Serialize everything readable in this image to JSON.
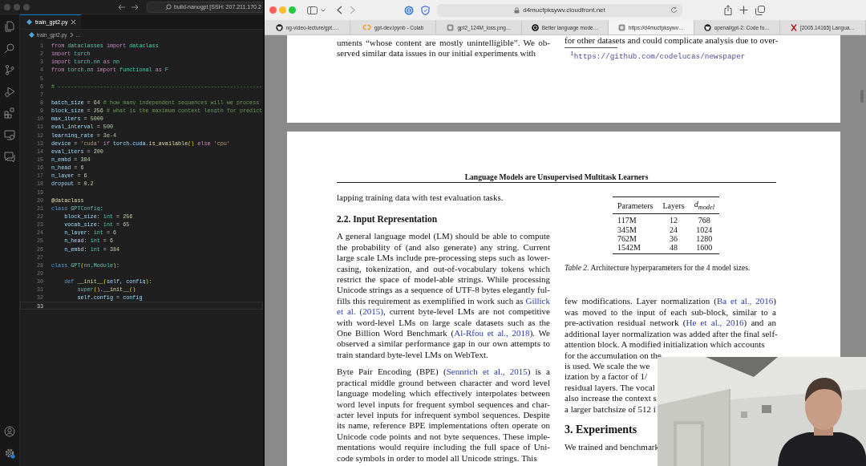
{
  "editor": {
    "command_center": "build-nanogpt [SSH: 207.211.170.2",
    "tab": {
      "label": "train_gpt2.py",
      "selected": true
    },
    "breadcrumb": [
      "train_gpt2.py",
      "..."
    ],
    "lines": [
      {
        "no": "1",
        "current": false,
        "tokens": [
          {
            "text": "from ",
            "kind": "keyword"
          },
          {
            "text": "dataclasses ",
            "kind": "module"
          },
          {
            "text": "import ",
            "kind": "keyword"
          },
          {
            "text": "dataclass",
            "kind": "module"
          }
        ]
      },
      {
        "no": "2",
        "current": false,
        "tokens": [
          {
            "text": "import ",
            "kind": "keyword"
          },
          {
            "text": "torch",
            "kind": "module"
          }
        ]
      },
      {
        "no": "3",
        "current": false,
        "tokens": [
          {
            "text": "import ",
            "kind": "keyword"
          },
          {
            "text": "torch.nn ",
            "kind": "module"
          },
          {
            "text": "as ",
            "kind": "keyword"
          },
          {
            "text": "nn",
            "kind": "module"
          }
        ]
      },
      {
        "no": "4",
        "current": false,
        "tokens": [
          {
            "text": "from ",
            "kind": "keyword"
          },
          {
            "text": "torch.nn ",
            "kind": "module"
          },
          {
            "text": "import ",
            "kind": "keyword"
          },
          {
            "text": "functional ",
            "kind": "module"
          },
          {
            "text": "as ",
            "kind": "keyword"
          },
          {
            "text": "F",
            "kind": "module"
          }
        ]
      },
      {
        "no": "5",
        "current": false
      },
      {
        "no": "6",
        "current": false,
        "tokens": [
          {
            "text": "# ---------------------------------------------------------------",
            "kind": "comment"
          }
        ]
      },
      {
        "no": "7",
        "current": false
      },
      {
        "no": "8",
        "current": false,
        "tokens": [
          {
            "text": "batch_size",
            "kind": "variable"
          },
          {
            "text": " = ",
            "kind": "plain"
          },
          {
            "text": "64",
            "kind": "number"
          },
          {
            "text": " # how many independent sequences will we process",
            "kind": "comment"
          }
        ]
      },
      {
        "no": "9",
        "current": false,
        "tokens": [
          {
            "text": "block_size",
            "kind": "variable"
          },
          {
            "text": " = ",
            "kind": "plain"
          },
          {
            "text": "256",
            "kind": "number"
          },
          {
            "text": " # what is the maximum context length for predict",
            "kind": "comment"
          }
        ]
      },
      {
        "no": "10",
        "current": false,
        "tokens": [
          {
            "text": "max_iters",
            "kind": "variable"
          },
          {
            "text": " = ",
            "kind": "plain"
          },
          {
            "text": "5000",
            "kind": "number"
          }
        ]
      },
      {
        "no": "11",
        "current": false,
        "tokens": [
          {
            "text": "eval_interval",
            "kind": "variable"
          },
          {
            "text": " = ",
            "kind": "plain"
          },
          {
            "text": "500",
            "kind": "number"
          }
        ]
      },
      {
        "no": "12",
        "current": false,
        "tokens": [
          {
            "text": "learning_rate",
            "kind": "variable"
          },
          {
            "text": " = ",
            "kind": "plain"
          },
          {
            "text": "3e-4",
            "kind": "number"
          }
        ]
      },
      {
        "no": "13",
        "current": false,
        "tokens": [
          {
            "text": "device",
            "kind": "variable"
          },
          {
            "text": " = ",
            "kind": "plain"
          },
          {
            "text": "'cuda'",
            "kind": "string"
          },
          {
            "text": " if ",
            "kind": "keyword"
          },
          {
            "text": "torch",
            "kind": "variable"
          },
          {
            "text": ".",
            "kind": "plain"
          },
          {
            "text": "cuda",
            "kind": "variable"
          },
          {
            "text": ".",
            "kind": "plain"
          },
          {
            "text": "is_available",
            "kind": "function"
          },
          {
            "text": "()",
            "kind": "bracket"
          },
          {
            "text": " else ",
            "kind": "keyword"
          },
          {
            "text": "'cpu'",
            "kind": "string"
          }
        ]
      },
      {
        "no": "14",
        "current": false,
        "tokens": [
          {
            "text": "eval_iters",
            "kind": "variable"
          },
          {
            "text": " = ",
            "kind": "plain"
          },
          {
            "text": "200",
            "kind": "number"
          }
        ]
      },
      {
        "no": "15",
        "current": false,
        "tokens": [
          {
            "text": "n_embd",
            "kind": "variable"
          },
          {
            "text": " = ",
            "kind": "plain"
          },
          {
            "text": "384",
            "kind": "number"
          }
        ]
      },
      {
        "no": "16",
        "current": false,
        "tokens": [
          {
            "text": "n_head",
            "kind": "variable"
          },
          {
            "text": " = ",
            "kind": "plain"
          },
          {
            "text": "6",
            "kind": "number"
          }
        ]
      },
      {
        "no": "17",
        "current": false,
        "tokens": [
          {
            "text": "n_layer",
            "kind": "variable"
          },
          {
            "text": " = ",
            "kind": "plain"
          },
          {
            "text": "6",
            "kind": "number"
          }
        ]
      },
      {
        "no": "18",
        "current": false,
        "tokens": [
          {
            "text": "dropout",
            "kind": "variable"
          },
          {
            "text": " = ",
            "kind": "plain"
          },
          {
            "text": "0.2",
            "kind": "number"
          }
        ]
      },
      {
        "no": "19",
        "current": false
      },
      {
        "no": "20",
        "current": false,
        "tokens": [
          {
            "text": "@dataclass",
            "kind": "function"
          }
        ]
      },
      {
        "no": "21",
        "current": false,
        "tokens": [
          {
            "text": "class ",
            "kind": "declaration"
          },
          {
            "text": "GPTConfig",
            "kind": "module"
          },
          {
            "text": ":",
            "kind": "plain"
          }
        ]
      },
      {
        "no": "22",
        "current": false,
        "tokens": [
          {
            "text": "    block_size",
            "kind": "variable"
          },
          {
            "text": ": ",
            "kind": "plain"
          },
          {
            "text": "int",
            "kind": "module"
          },
          {
            "text": " = ",
            "kind": "plain"
          },
          {
            "text": "256",
            "kind": "number"
          }
        ]
      },
      {
        "no": "23",
        "current": false,
        "tokens": [
          {
            "text": "    vocab_size",
            "kind": "variable"
          },
          {
            "text": ": ",
            "kind": "plain"
          },
          {
            "text": "int",
            "kind": "module"
          },
          {
            "text": " = ",
            "kind": "plain"
          },
          {
            "text": "65",
            "kind": "number"
          }
        ]
      },
      {
        "no": "24",
        "current": false,
        "tokens": [
          {
            "text": "    n_layer",
            "kind": "variable"
          },
          {
            "text": ": ",
            "kind": "plain"
          },
          {
            "text": "int",
            "kind": "module"
          },
          {
            "text": " = ",
            "kind": "plain"
          },
          {
            "text": "6",
            "kind": "number"
          }
        ]
      },
      {
        "no": "25",
        "current": false,
        "tokens": [
          {
            "text": "    n_head",
            "kind": "variable"
          },
          {
            "text": ": ",
            "kind": "plain"
          },
          {
            "text": "int",
            "kind": "module"
          },
          {
            "text": " = ",
            "kind": "plain"
          },
          {
            "text": "6",
            "kind": "number"
          }
        ]
      },
      {
        "no": "26",
        "current": false,
        "tokens": [
          {
            "text": "    n_embd",
            "kind": "variable"
          },
          {
            "text": ": ",
            "kind": "plain"
          },
          {
            "text": "int",
            "kind": "module"
          },
          {
            "text": " = ",
            "kind": "plain"
          },
          {
            "text": "384",
            "kind": "number"
          }
        ]
      },
      {
        "no": "27",
        "current": false
      },
      {
        "no": "28",
        "current": false,
        "tokens": [
          {
            "text": "class ",
            "kind": "declaration"
          },
          {
            "text": "GPT",
            "kind": "module"
          },
          {
            "text": "(",
            "kind": "bracket"
          },
          {
            "text": "nn",
            "kind": "module"
          },
          {
            "text": ".",
            "kind": "plain"
          },
          {
            "text": "Module",
            "kind": "module"
          },
          {
            "text": ")",
            "kind": "bracket"
          },
          {
            "text": ":",
            "kind": "plain"
          }
        ]
      },
      {
        "no": "29",
        "current": false
      },
      {
        "no": "30",
        "current": false,
        "tokens": [
          {
            "text": "    def ",
            "kind": "declaration"
          },
          {
            "text": "__init__",
            "kind": "function"
          },
          {
            "text": "(",
            "kind": "bracket"
          },
          {
            "text": "self",
            "kind": "variable"
          },
          {
            "text": ", ",
            "kind": "plain"
          },
          {
            "text": "config",
            "kind": "variable"
          },
          {
            "text": ")",
            "kind": "bracket"
          },
          {
            "text": ":",
            "kind": "plain"
          }
        ]
      },
      {
        "no": "31",
        "current": false,
        "tokens": [
          {
            "text": "        super",
            "kind": "module"
          },
          {
            "text": "()",
            "kind": "bracket"
          },
          {
            "text": ".",
            "kind": "plain"
          },
          {
            "text": "__init__",
            "kind": "function"
          },
          {
            "text": "()",
            "kind": "bracket"
          }
        ]
      },
      {
        "no": "32",
        "current": false,
        "tokens": [
          {
            "text": "        self",
            "kind": "variable"
          },
          {
            "text": ".",
            "kind": "plain"
          },
          {
            "text": "config",
            "kind": "variable"
          },
          {
            "text": " = ",
            "kind": "plain"
          },
          {
            "text": "config",
            "kind": "variable"
          }
        ]
      },
      {
        "no": "33",
        "current": true
      }
    ]
  },
  "browser": {
    "address": "d4mucfpksywv.cloudfront.net",
    "tabs": [
      {
        "label": "ng-video-lecture/gpt.…",
        "kind": "github",
        "selected": false
      },
      {
        "label": "gpt-dev.ipynb - Colab",
        "kind": "colab",
        "selected": false
      },
      {
        "label": "gpt2_124M_loss.png…",
        "kind": "page",
        "selected": false
      },
      {
        "label": "Better language mode…",
        "kind": "openai",
        "selected": false
      },
      {
        "label": "https://d4mucfpksywv…",
        "kind": "page",
        "selected": true
      },
      {
        "label": "openai/gpt-2: Code fo…",
        "kind": "github",
        "selected": false
      },
      {
        "label": "[2005.14165] Langua…",
        "kind": "arxiv",
        "selected": false
      }
    ]
  },
  "paper": {
    "page1": {
      "left": [
        {
          "kind": "text",
          "lines": [
            "uments “whose content are mostly unintelligible”. We ob-",
            "served similar data issues in our initial experiments with"
          ]
        }
      ],
      "right": [
        {
          "kind": "text",
          "lines": [
            "for other datasets and could complicate analysis due to over-"
          ]
        },
        {
          "kind": "footnote",
          "text": "$^{1}$https://github.com/codelucas/newspaper"
        }
      ]
    },
    "page2": {
      "running_title": "Language Models are Unsupervised Multitask Learners",
      "left": [
        {
          "kind": "text",
          "lines": [
            "lapping training data with test evaluation tasks."
          ]
        },
        {
          "kind": "heading",
          "text": "2.2. Input Representation"
        },
        {
          "kind": "text",
          "lines": [
            "A general language model (LM) should be able to compute",
            "the probability of (and also generate) any string.  Current",
            "large scale LMs include pre-processing steps such as lower-",
            "casing, tokenization, and out-of-vocabulary tokens which",
            "restrict the space of model-able strings. While processing",
            "Unicode strings as a sequence of UTF-8 bytes elegantly ful-",
            [
              {
                "text": "fills this requirement as exemplified in work such as "
              },
              {
                "text": "Gillick",
                "link": true
              }
            ],
            [
              {
                "text": "et al. (2015)",
                "link": true
              },
              {
                "text": ", current byte-level LMs are not competitive"
              }
            ],
            "with word-level LMs on large scale datasets such as the",
            [
              {
                "text": "One Billion Word Benchmark ("
              },
              {
                "text": "Al-Rfou et al., 2018",
                "link": true
              },
              {
                "text": "). We"
              }
            ],
            "observed a similar performance gap in our own attempts to",
            "train standard byte-level LMs on WebText."
          ]
        },
        {
          "kind": "text",
          "lines": [
            [
              {
                "text": "Byte Pair Encoding (BPE) ("
              },
              {
                "text": "Sennrich et al., 2015",
                "link": true
              },
              {
                "text": ") is a"
              }
            ],
            "practical middle ground between character and word level",
            "language modeling which effectively interpolates between",
            "word level inputs for frequent symbol sequences and char-",
            "acter level inputs for infrequent symbol sequences. Despite",
            "its name, reference BPE implementations often operate on",
            "Unicode code points and not byte sequences. These imple-",
            "mentations would require including the full space of Uni-",
            "code symbols in order to model all Unicode strings. This"
          ]
        }
      ],
      "right": [
        {
          "kind": "table",
          "columns": [
            "Parameters",
            "Layers",
            "d$_{model}$"
          ],
          "rows": [
            [
              "117M",
              "12",
              "768"
            ],
            [
              "345M",
              "24",
              "1024"
            ],
            [
              "762M",
              "36",
              "1280"
            ],
            [
              "1542M",
              "48",
              "1600"
            ]
          ]
        },
        {
          "kind": "caption",
          "text": "*Table 2.* Architecture hyperparameters for the 4 model sizes."
        },
        {
          "kind": "text",
          "lines": [
            [
              {
                "text": "few modifications. Layer normalization ("
              },
              {
                "text": "Ba et al., 2016",
                "link": true
              },
              {
                "text": ")"
              }
            ],
            "was moved to the input of each sub-block, similar to a",
            [
              {
                "text": "pre-activation residual network ("
              },
              {
                "text": "He et al., 2016",
                "link": true
              },
              {
                "text": ") and an"
              }
            ],
            "additional layer normalization was added after the final self-",
            "attention block. A modified initialization which accounts"
          ]
        },
        {
          "kind": "text_partly_hidden",
          "lines": [
            "for the accumulation on the",
            "is used. We scale the we",
            "ization by a factor of 1/",
            "residual layers. The vocal",
            "also increase the context s",
            "a larger batchsize of 512 i"
          ]
        },
        {
          "kind": "section_heading",
          "text": "3. Experiments"
        },
        {
          "kind": "text_partly_hidden",
          "lines": [
            "We trained and benchmark"
          ]
        }
      ]
    }
  }
}
